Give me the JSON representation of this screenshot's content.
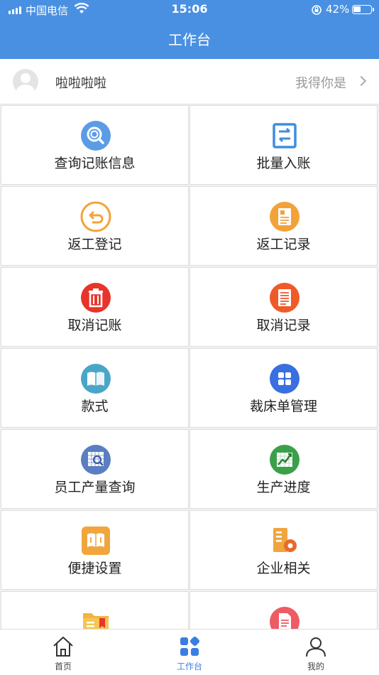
{
  "status_bar": {
    "carrier": "中国电信",
    "time": "15:06",
    "battery": "42%"
  },
  "header": {
    "title": "工作台"
  },
  "profile": {
    "name": "啦啦啦啦",
    "right_text": "我得你是"
  },
  "grid": [
    {
      "label": "查询记账信息",
      "icon": "search-icon"
    },
    {
      "label": "批量入账",
      "icon": "batch-entry-icon"
    },
    {
      "label": "返工登记",
      "icon": "rework-return-icon"
    },
    {
      "label": "返工记录",
      "icon": "rework-record-icon"
    },
    {
      "label": "取消记账",
      "icon": "trash-icon"
    },
    {
      "label": "取消记录",
      "icon": "cancel-record-icon"
    },
    {
      "label": "款式",
      "icon": "book-icon"
    },
    {
      "label": "裁床单管理",
      "icon": "grid-apps-icon"
    },
    {
      "label": "员工产量查询",
      "icon": "chart-search-icon"
    },
    {
      "label": "生产进度",
      "icon": "trend-chart-icon"
    },
    {
      "label": "便捷设置",
      "icon": "settings-book-icon"
    },
    {
      "label": "企业相关",
      "icon": "enterprise-gear-icon"
    },
    {
      "label": "",
      "icon": "folder-bookmark-icon"
    },
    {
      "label": "",
      "icon": "document-icon"
    }
  ],
  "tabbar": [
    {
      "label": "首页",
      "icon": "home-icon",
      "active": false
    },
    {
      "label": "工作台",
      "icon": "workbench-icon",
      "active": true
    },
    {
      "label": "我的",
      "icon": "user-icon",
      "active": false
    }
  ],
  "colors": {
    "header": "#4a90e2",
    "tab_active": "#3a7fe0"
  }
}
